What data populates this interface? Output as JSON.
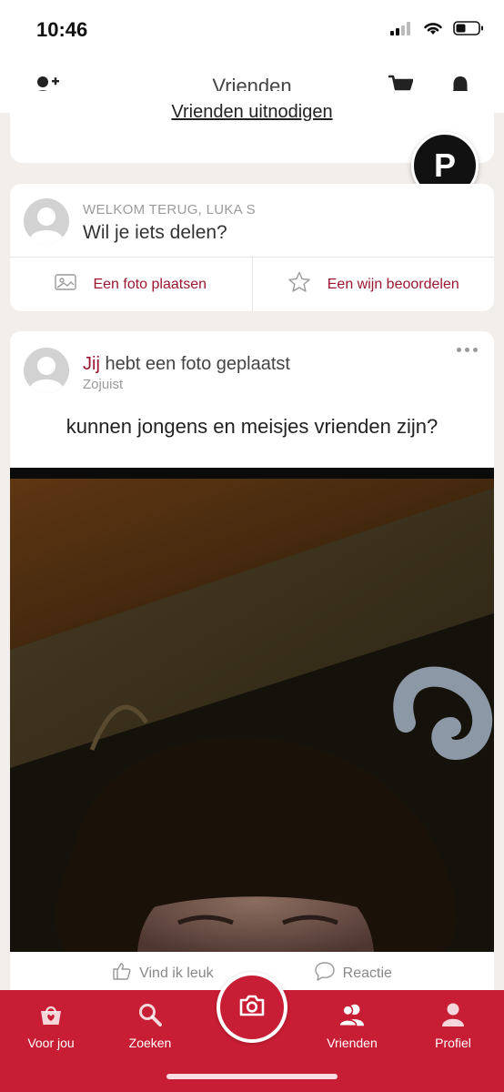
{
  "status_bar": {
    "time": "10:46",
    "battery_level": 0.4
  },
  "header": {
    "title": "Vrienden",
    "icons": [
      "add-friend-icon",
      "cart-icon",
      "bell-icon"
    ]
  },
  "invite": {
    "link_label": "Vrienden uitnodigen"
  },
  "fab": {
    "label": "P"
  },
  "share": {
    "welcome": "WELKOM TERUG, LUKA S",
    "prompt": "Wil je iets delen?",
    "photo_label": "Een foto plaatsen",
    "rate_label": "Een wijn beoordelen"
  },
  "post": {
    "author_highlight": "Jij",
    "author_rest": " hebt een foto geplaatst",
    "time": "Zojuist",
    "text": "kunnen jongens en meisjes vrienden zijn?",
    "like_label": "Vind ik leuk",
    "comment_label": "Reactie"
  },
  "tabs": [
    {
      "label": "Voor jou",
      "icon": "bag-icon"
    },
    {
      "label": "Zoeken",
      "icon": "search-icon"
    },
    {
      "label": "Vrienden",
      "icon": "friends-icon"
    },
    {
      "label": "Profiel",
      "icon": "profile-icon"
    }
  ],
  "colors": {
    "accent": "#9b1730",
    "tab_bar": "#c81e35",
    "background": "#f2eeeb"
  }
}
